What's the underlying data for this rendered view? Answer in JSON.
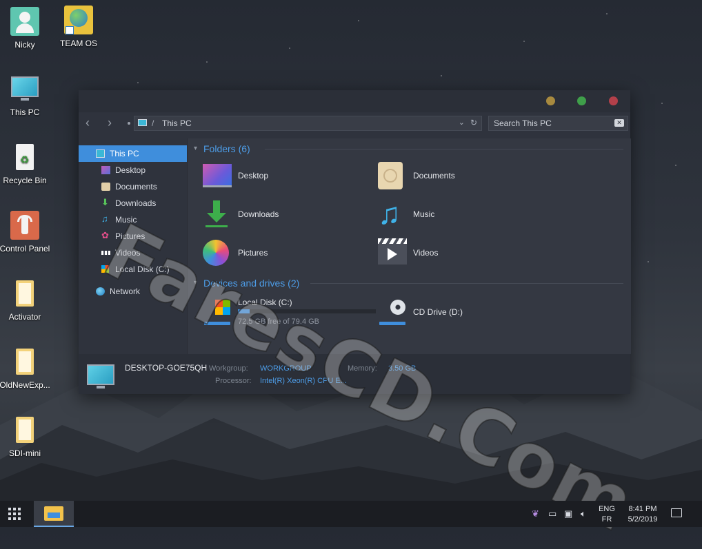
{
  "desktop": {
    "icons": [
      {
        "label": "Nicky"
      },
      {
        "label": "TEAM OS"
      },
      {
        "label": "This PC"
      },
      {
        "label": "Recycle Bin"
      },
      {
        "label": "Control Panel"
      },
      {
        "label": "Activator"
      },
      {
        "label": "OldNewExp..."
      },
      {
        "label": "SDI-mini"
      }
    ]
  },
  "window": {
    "address": {
      "path": "This PC",
      "separator": "/"
    },
    "search": {
      "placeholder": "Search This PC"
    },
    "sidebar": {
      "items": [
        {
          "label": "This PC",
          "icon": "monitor-icon"
        },
        {
          "label": "Desktop",
          "icon": "desktop-icon"
        },
        {
          "label": "Documents",
          "icon": "document-icon"
        },
        {
          "label": "Downloads",
          "icon": "download-icon"
        },
        {
          "label": "Music",
          "icon": "music-icon"
        },
        {
          "label": "Pictures",
          "icon": "pictures-icon"
        },
        {
          "label": "Videos",
          "icon": "videos-icon"
        },
        {
          "label": "Local Disk (C:)",
          "icon": "windows-drive-icon"
        },
        {
          "label": "Network",
          "icon": "network-icon"
        }
      ]
    },
    "folders": {
      "heading": "Folders (6)",
      "items": [
        {
          "label": "Desktop"
        },
        {
          "label": "Documents"
        },
        {
          "label": "Downloads"
        },
        {
          "label": "Music"
        },
        {
          "label": "Pictures"
        },
        {
          "label": "Videos"
        }
      ]
    },
    "drives": {
      "heading": "Devices and drives (2)",
      "items": [
        {
          "label": "Local Disk (C:)",
          "free_text": "72.5 GB free of 79.4 GB",
          "used_fraction": 0.087
        },
        {
          "label": "CD Drive (D:)"
        }
      ]
    },
    "details": {
      "computer_name": "DESKTOP-GOE75QH",
      "workgroup_label": "Workgroup:",
      "workgroup": "WORKGROUP",
      "memory_label": "Memory:",
      "memory": "3.50 GB",
      "processor_label": "Processor:",
      "processor": "Intel(R) Xeon(R) CPU E..."
    }
  },
  "watermark": "FaresCD.Com",
  "taskbar": {
    "lang_top": "ENG",
    "lang_bottom": "FR",
    "time": "8:41 PM",
    "date": "5/2/2019"
  },
  "colors": {
    "accent": "#3f8edc",
    "link": "#4d9de8"
  }
}
